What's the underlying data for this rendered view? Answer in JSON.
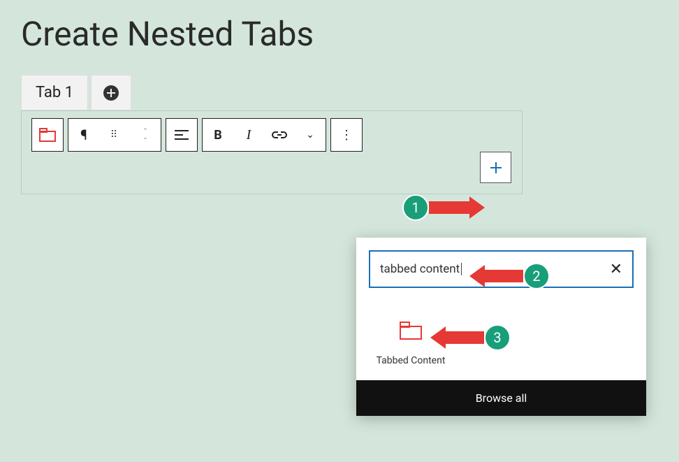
{
  "page": {
    "title": "Create Nested Tabs"
  },
  "tabs": {
    "active_label": "Tab 1"
  },
  "toolbar": {
    "block_icon": "tabbed-content-icon",
    "paragraph_icon": "pilcrow-icon",
    "drag_icon": "drag-handle-icon",
    "move_icon": "up-down-icon",
    "align_icon": "align-left-icon",
    "bold_label": "B",
    "italic_label": "I",
    "link_icon": "link-icon",
    "dropdown_icon": "chevron-down-icon",
    "options_icon": "more-vertical-icon"
  },
  "inserter": {
    "plus_icon": "plus-icon"
  },
  "search": {
    "value": "tabbed content",
    "clear_label": "✕"
  },
  "result": {
    "label": "Tabbed Content",
    "icon": "tabbed-content-icon"
  },
  "browse_all_label": "Browse all",
  "annotations": {
    "step1": "1",
    "step2": "2",
    "step3": "3"
  }
}
